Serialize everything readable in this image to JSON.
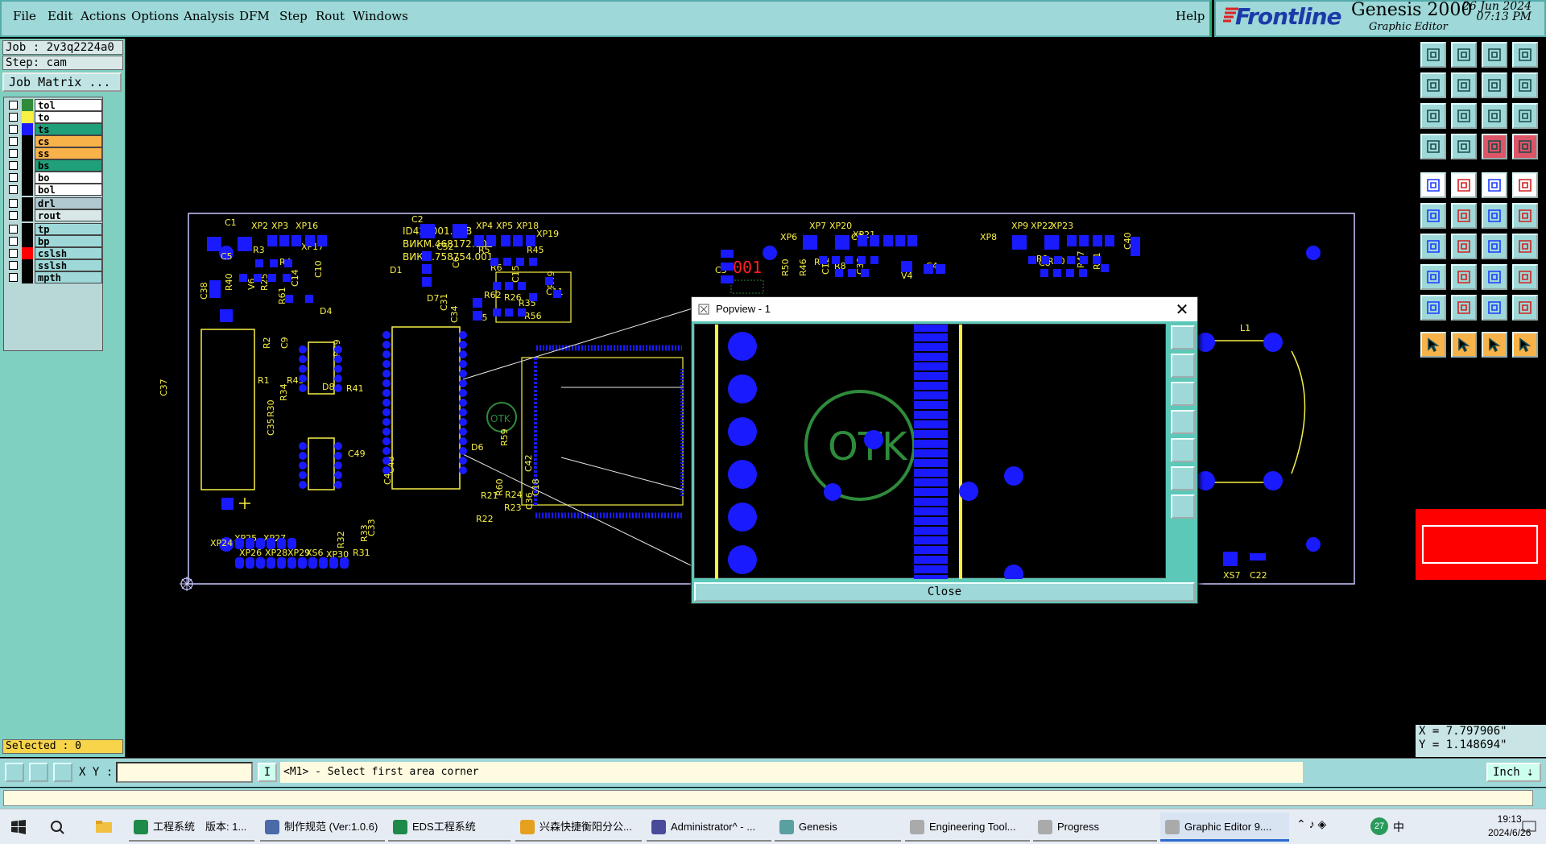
{
  "menu": {
    "items": [
      "File",
      "Edit",
      "Actions",
      "Options",
      "Analysis",
      "DFM",
      "Step",
      "Rout",
      "Windows"
    ],
    "help": "Help"
  },
  "brand": {
    "logo": "Frontline",
    "product": "Genesis 2000",
    "subtitle": "Graphic Editor",
    "date": "26 Jun 2024",
    "time": "07:13 PM"
  },
  "left_panel": {
    "job": "Job : 2v3q2224a0",
    "step": "Step: cam",
    "job_matrix_button": "Job Matrix ...",
    "layers": [
      {
        "name": "tol",
        "swatch": "#2e8b3a",
        "bg": "#ffffff"
      },
      {
        "name": "to",
        "swatch": "#f7f045",
        "bg": "#ffffff"
      },
      {
        "name": "ts",
        "swatch": "#1a1aff",
        "bg": "#1fa07a"
      },
      {
        "name": "cs",
        "swatch": "#000000",
        "bg": "#f7b24a"
      },
      {
        "name": "ss",
        "swatch": "#000000",
        "bg": "#f7b24a"
      },
      {
        "name": "bs",
        "swatch": "#000000",
        "bg": "#1fa07a"
      },
      {
        "name": "bo",
        "swatch": "#000000",
        "bg": "#ffffff"
      },
      {
        "name": "bol",
        "swatch": "#000000",
        "bg": "#ffffff"
      },
      {
        "name": "drl",
        "swatch": "#000000",
        "bg": "#b0c8d0"
      },
      {
        "name": "rout",
        "swatch": "#000000",
        "bg": "#d8e8e8"
      },
      {
        "name": "tp",
        "swatch": "#000000",
        "bg": "#9ed8d8"
      },
      {
        "name": "bp",
        "swatch": "#000000",
        "bg": "#9ed8d8"
      },
      {
        "name": "cslsh",
        "swatch": "#ff0000",
        "bg": "#9ed8d8"
      },
      {
        "name": "sslsh",
        "swatch": "#000000",
        "bg": "#9ed8d8"
      },
      {
        "name": "mpth",
        "swatch": "#000000",
        "bg": "#9ed8d8"
      }
    ],
    "selected": "Selected : 0"
  },
  "pcb_labels": {
    "title": [
      "ID425001.PCB",
      "ВИКМ.468172.002",
      "ВИКМ.758754.001"
    ],
    "red_code": "001",
    "refs": [
      "C1",
      "XP2",
      "XP3",
      "XP16",
      "XP17",
      "R3",
      "R4",
      "C5",
      "R40",
      "V6",
      "R25",
      "R61",
      "C14",
      "C10",
      "D1",
      "C2",
      "C52",
      "C6",
      "XP4",
      "XP5",
      "XP18",
      "XP19",
      "R5",
      "R45",
      "R6",
      "R62",
      "R26",
      "C15",
      "R35",
      "C11",
      "R49",
      "C31",
      "C34",
      "D5",
      "R56",
      "D7",
      "D4",
      "R2",
      "C9",
      "R39",
      "R1",
      "R43",
      "R34",
      "D8",
      "R41",
      "R30",
      "C35",
      "C49",
      "C47",
      "C48",
      "R59",
      "D6",
      "C42",
      "R60",
      "C36",
      "R21",
      "R24",
      "R22",
      "R23",
      "C18",
      "XP24",
      "XP25",
      "XP26",
      "XP27",
      "XP28",
      "XP29",
      "XS6",
      "XP30",
      "R31",
      "R32",
      "R33",
      "C33",
      "C37",
      "C38",
      "C3",
      "XP6",
      "XP7",
      "XP20",
      "XP21",
      "C7",
      "R7",
      "R8",
      "C39",
      "R50",
      "R46",
      "C12",
      "V4",
      "C4",
      "XP8",
      "XP9",
      "XP22",
      "XP23",
      "R9",
      "R10",
      "R47",
      "R51",
      "C8",
      "C40",
      "L1",
      "XS7",
      "C22"
    ]
  },
  "popview": {
    "title": "Popview - 1",
    "close_label": "Close",
    "otk_text": "OTK"
  },
  "coords": {
    "x": "X = 7.797906\"",
    "y": "Y = 1.148694\""
  },
  "status": {
    "xy_label": "X Y :",
    "mode_button": "I",
    "message": "<M1> - Select first area corner",
    "units": "Inch"
  },
  "taskbar": {
    "tasks": [
      {
        "label": "工程系统　版本: 1...",
        "color": "#1e8a4a"
      },
      {
        "label": "制作规范 (Ver:1.0.6)",
        "color": "#4a6aa8"
      },
      {
        "label": "EDS工程系统",
        "color": "#1e8a4a"
      },
      {
        "label": "兴森快捷衡阳分公...",
        "color": "#e6a020"
      },
      {
        "label": "Administrator^ - ...",
        "color": "#4a4a9a"
      },
      {
        "label": "Genesis",
        "color": "#5aa0a0"
      },
      {
        "label": "Engineering Tool...",
        "color": "#aaaaaa"
      },
      {
        "label": "Progress",
        "color": "#aaaaaa"
      },
      {
        "label": "Graphic Editor 9....",
        "color": "#aaaaaa"
      }
    ],
    "tray_badge": "27",
    "tray_ime": "中",
    "clock_time": "19:13",
    "clock_date": "2024/6/26"
  },
  "colors": {
    "pad": "#1a1aff",
    "silk": "#f7f045",
    "outline": "#c8c8ff",
    "otk": "#2e8b3a",
    "red_marker": "#ff0000"
  }
}
